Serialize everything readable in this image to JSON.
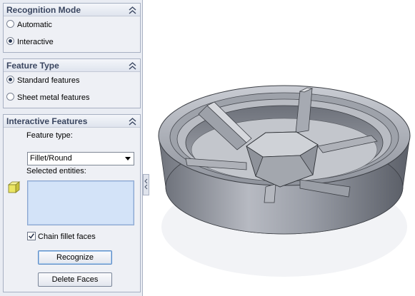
{
  "recognition_mode": {
    "title": "Recognition Mode",
    "options": [
      {
        "label": "Automatic",
        "selected": false
      },
      {
        "label": "Interactive",
        "selected": true
      }
    ]
  },
  "feature_type": {
    "title": "Feature Type",
    "options": [
      {
        "label": "Standard features",
        "selected": true
      },
      {
        "label": "Sheet metal features",
        "selected": false
      }
    ]
  },
  "interactive_features": {
    "title": "Interactive Features",
    "feature_type_label": "Feature type:",
    "feature_type_value": "Fillet/Round",
    "selected_entities_label": "Selected entities:",
    "chain_fillet_label": "Chain fillet faces",
    "chain_fillet_checked": true,
    "recognize_label": "Recognize",
    "delete_faces_label": "Delete Faces"
  },
  "icons": {
    "collapse": "double-chevron-up-icon",
    "selection": "face-cube-icon",
    "dropdown": "chevron-down-icon",
    "splitter": "collapse-panel-left-icon"
  },
  "colors": {
    "panel_bg": "#e9ecf3",
    "header_text": "#3a4660",
    "selection_box": "#d3e3f8",
    "model_gray": "#8c909a"
  }
}
